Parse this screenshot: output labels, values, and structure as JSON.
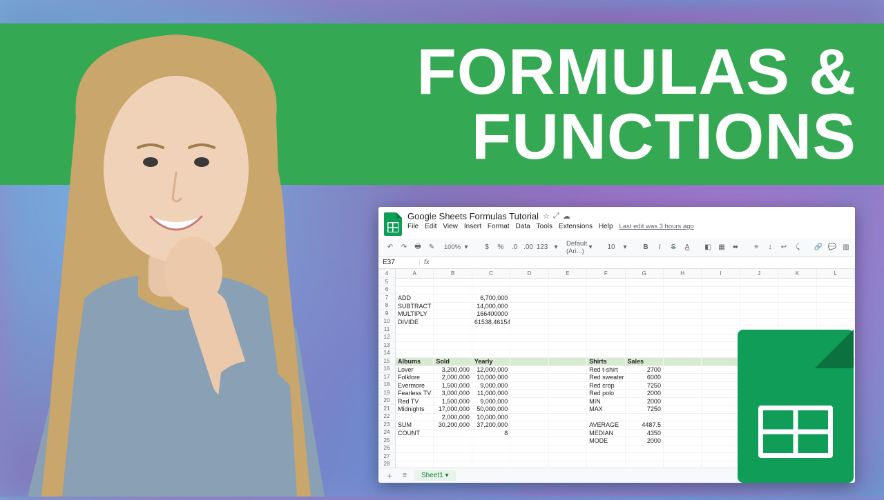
{
  "title": {
    "line1": "FORMULAS &",
    "line2": "FUNCTIONS"
  },
  "doc": {
    "title": "Google Sheets Formulas Tutorial",
    "menus": [
      "File",
      "Edit",
      "View",
      "Insert",
      "Format",
      "Data",
      "Tools",
      "Extensions",
      "Help"
    ],
    "last_edit": "Last edit was 3 hours ago",
    "zoom": "100%",
    "currency": "$",
    "percent": "%",
    "dec": ".0",
    "dec2": ".00",
    "num_format": "123",
    "font": "Default (Ari...)",
    "cell_ref": "E37",
    "fx": "fx",
    "tab_name": "Sheet1",
    "font_size": "10"
  },
  "columns": [
    "A",
    "B",
    "C",
    "D",
    "E",
    "F",
    "G",
    "H",
    "I",
    "J",
    "K",
    "L"
  ],
  "rows_start": 4,
  "ops": [
    {
      "row": 6,
      "label": "ADD",
      "value": "6,700,000"
    },
    {
      "row": 7,
      "label": "SUBTRACT",
      "value": "14,000,000"
    },
    {
      "row": 8,
      "label": "MULTIPLY",
      "value": "166400000"
    },
    {
      "row": 9,
      "label": "DIVIDE",
      "value": "61538.46154"
    }
  ],
  "table1_header_row": 14,
  "table1_headers": [
    "Albums",
    "Sold",
    "Yearly"
  ],
  "table2_headers": [
    "Shirts",
    "Sales"
  ],
  "albums": [
    {
      "name": "Lover",
      "sold": "3,200,000",
      "yearly": "12,000,000",
      "shirt": "Red t-shirt",
      "sales": "2700"
    },
    {
      "name": "Folklore",
      "sold": "2,000,000",
      "yearly": "10,000,000",
      "shirt": "Red sweater",
      "sales": "6000"
    },
    {
      "name": "Evermore",
      "sold": "1,500,000",
      "yearly": "9,000,000",
      "shirt": "Red crop",
      "sales": "7250"
    },
    {
      "name": "Fearless TV",
      "sold": "3,000,000",
      "yearly": "11,000,000",
      "shirt": "Red polo",
      "sales": "2000"
    },
    {
      "name": "Red TV",
      "sold": "1,500,000",
      "yearly": "9,000,000",
      "shirt": "MIN",
      "sales": "2000"
    },
    {
      "name": "Midnights",
      "sold": "17,000,000",
      "yearly": "50,000,000",
      "shirt": "MAX",
      "sales": "7250"
    },
    {
      "name": "",
      "sold": "2,000,000",
      "yearly": "10,000,000",
      "shirt": "",
      "sales": ""
    }
  ],
  "summary": [
    {
      "label": "SUM",
      "sold": "30,200,000",
      "yearly": "37,200,000",
      "stat": "AVERAGE",
      "val": "4487.5"
    },
    {
      "label": "COUNT",
      "sold": "",
      "yearly": "8",
      "stat": "MEDIAN",
      "val": "4350"
    },
    {
      "label": "",
      "sold": "",
      "yearly": "",
      "stat": "MODE",
      "val": "2000"
    }
  ]
}
